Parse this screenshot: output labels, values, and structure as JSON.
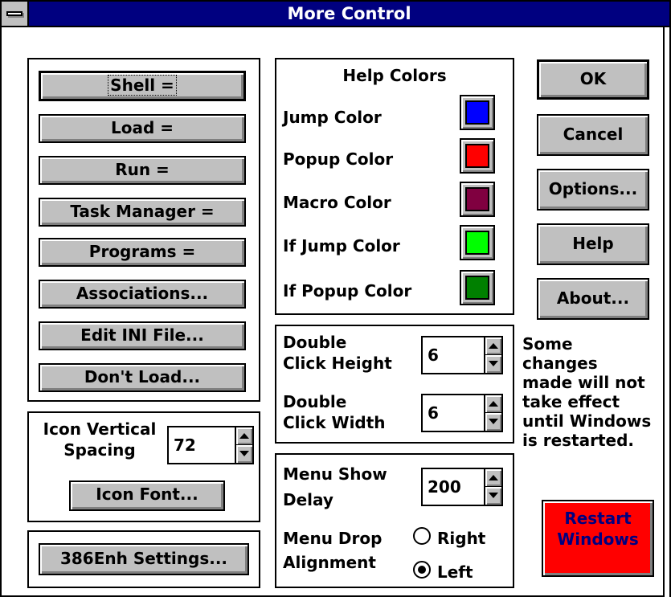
{
  "window": {
    "title": "More Control"
  },
  "left_group": {
    "buttons": [
      "Shell =",
      "Load =",
      "Run =",
      "Task Manager =",
      "Programs =",
      "Associations...",
      "Edit INI File...",
      "Don't Load..."
    ]
  },
  "icon_group": {
    "label_line1": "Icon Vertical",
    "label_line2": "Spacing",
    "value": "72",
    "font_button": "Icon Font..."
  },
  "enh_group": {
    "button": "386Enh Settings..."
  },
  "help_colors": {
    "title": "Help Colors",
    "items": [
      {
        "label": "Jump Color",
        "color": "#0000ff"
      },
      {
        "label": "Popup Color",
        "color": "#ff0000"
      },
      {
        "label": "Macro Color",
        "color": "#800040"
      },
      {
        "label": "If Jump Color",
        "color": "#00ff00"
      },
      {
        "label": "If Popup Color",
        "color": "#008000"
      }
    ]
  },
  "double_click": {
    "height_label_1": "Double",
    "height_label_2": "Click Height",
    "height_value": "6",
    "width_label_1": "Double",
    "width_label_2": "Click Width",
    "width_value": "6"
  },
  "menu": {
    "delay_label_1": "Menu Show",
    "delay_label_2": "Delay",
    "delay_value": "200",
    "align_label_1": "Menu Drop",
    "align_label_2": "Alignment",
    "option_right": "Right",
    "option_left": "Left",
    "selected": "Left"
  },
  "actions": {
    "ok": "OK",
    "cancel": "Cancel",
    "options": "Options...",
    "help": "Help",
    "about": "About..."
  },
  "note": {
    "lines": [
      "Some",
      "changes",
      "made will not",
      "take effect",
      "until Windows",
      "is restarted."
    ]
  },
  "restart": {
    "line1": "Restart",
    "line2": "Windows",
    "color": "#ff0000"
  }
}
